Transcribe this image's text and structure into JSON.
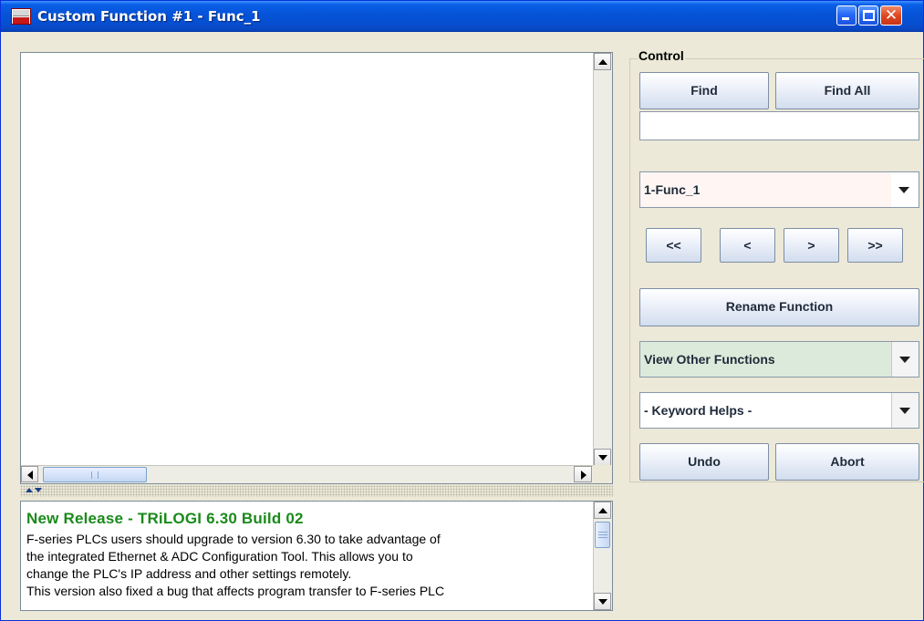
{
  "window": {
    "title": "Custom Function #1 - Func_1",
    "icon": "trilogi-basic-app-icon",
    "icon_text_top": "TBASIC",
    "icon_text_bottom": "BASIC"
  },
  "news": {
    "title": "New Release - TRiLOGI 6.30 Build 02",
    "lines": [
      "F-series PLCs users should upgrade to version 6.30 to take advantage of",
      "the integrated Ethernet & ADC Configuration Tool. This allows you to",
      "change the PLC's IP address and other settings remotely.",
      "This version also fixed a bug that affects program transfer to F-series PLC"
    ],
    "title_color": "#1a8a1a"
  },
  "control": {
    "legend": "Control",
    "find_label": "Find",
    "find_all_label": "Find All",
    "find_input_value": "",
    "function_select": "1-Func_1",
    "nav": {
      "first": "<<",
      "prev": "<",
      "next": ">",
      "last": ">>"
    },
    "rename_label": "Rename Function",
    "view_other_label": "View Other Functions",
    "keyword_helps_label": "- Keyword Helps -",
    "undo_label": "Undo",
    "abort_label": "Abort"
  },
  "colors": {
    "titlebar": "#0653d8",
    "window_bg": "#ece9d8",
    "function_select_bg": "#fff6f3",
    "view_other_bg": "#dceadb"
  }
}
